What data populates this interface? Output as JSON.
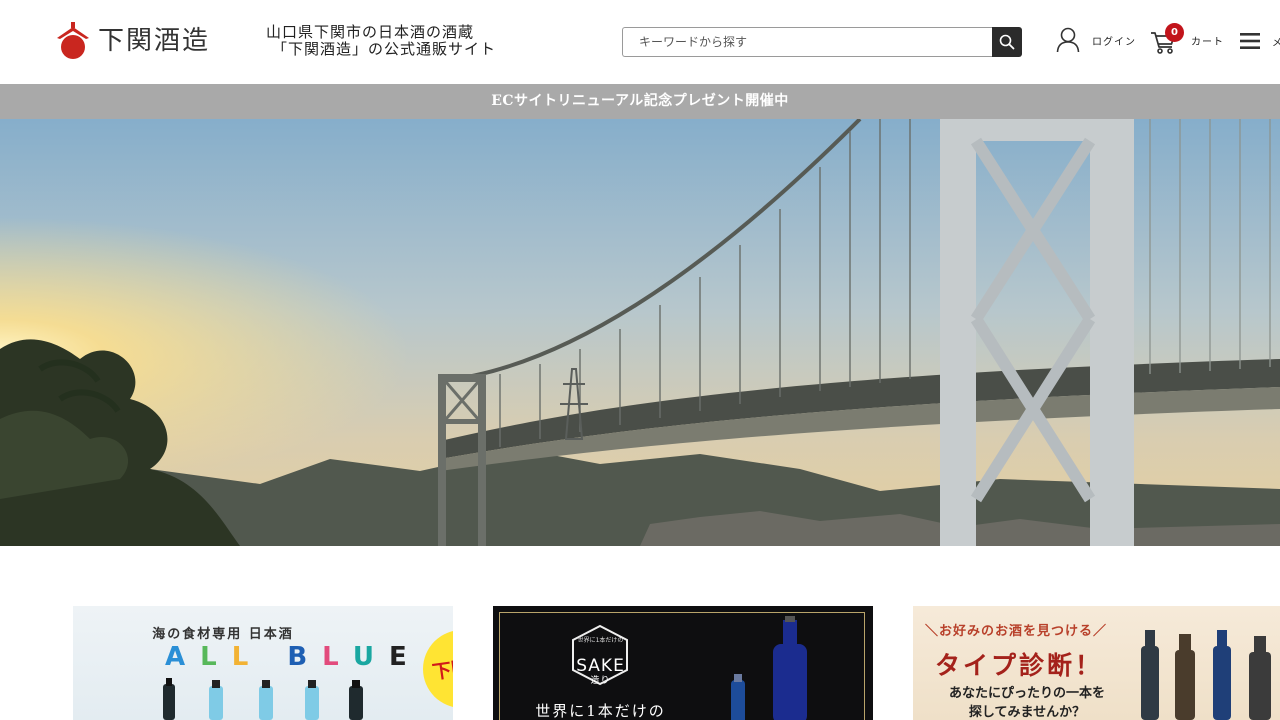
{
  "header": {
    "logo_text": "下関酒造",
    "tagline_line1": "山口県下関市の日本酒の酒蔵",
    "tagline_line2": "「下関酒造」の公式通販サイト",
    "search": {
      "placeholder": "キーワードから探す"
    },
    "login_label": "ログイン",
    "cart_label": "カート",
    "cart_count": "0",
    "menu_label": "メ"
  },
  "announcement": {
    "text": "ECサイトリニューアル記念プレゼント開催中"
  },
  "banners": [
    {
      "subtitle": "海の食材専用 日本酒",
      "title_letters": [
        "A",
        "L",
        "L",
        "B",
        "L",
        "U",
        "E"
      ],
      "badge": "下関初"
    },
    {
      "emblem_small": "世界に1本だけの",
      "emblem": "SAKE",
      "emblem_sub": "造り",
      "tagline": "世界に1本だけの"
    },
    {
      "lead": "＼お好みのお酒を見つける／",
      "title": "タイプ診断！",
      "body_line1": "あなたにぴったりの一本を",
      "body_line2": "探してみませんか？"
    }
  ],
  "colors": {
    "accent_red": "#c2141b",
    "announce_bg": "#a9a9a9",
    "search_button": "#2b2b2b"
  }
}
